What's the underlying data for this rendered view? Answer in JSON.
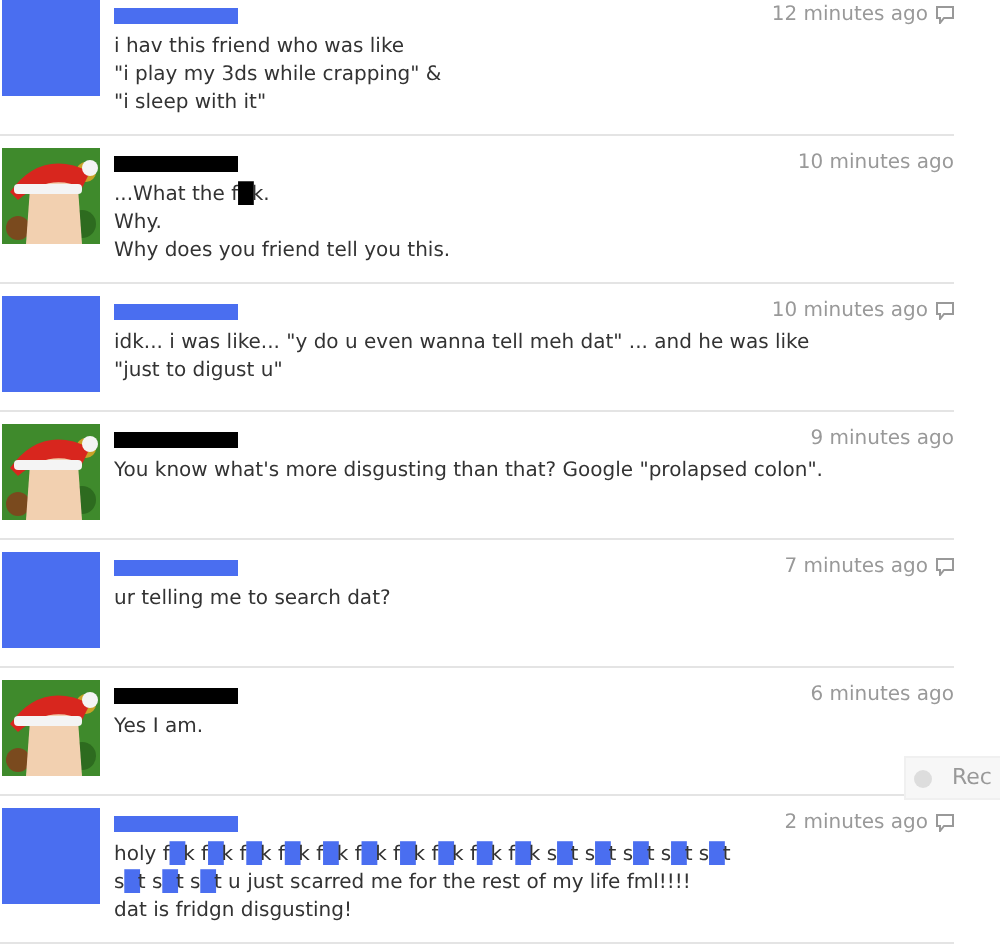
{
  "messages": [
    {
      "avatar": {
        "kind": "blue"
      },
      "color": "#4a6ef0",
      "time": "12 minutes ago",
      "comment_icon": true,
      "lines": [
        "i hav this friend who was like",
        "\"i play my 3ds while crapping\" &",
        "\"i sleep with it\""
      ]
    },
    {
      "avatar": {
        "kind": "picture"
      },
      "color": "#000000",
      "time": "10 minutes ago",
      "comment_icon": false,
      "lines": [
        "...What the f█k.",
        "Why.",
        "Why does you friend tell you this."
      ]
    },
    {
      "avatar": {
        "kind": "blue"
      },
      "color": "#4a6ef0",
      "time": "10 minutes ago",
      "comment_icon": true,
      "lines": [
        "idk... i was like... \"y do u even wanna tell meh dat\" ... and he was like",
        "\"just to digust u\""
      ]
    },
    {
      "avatar": {
        "kind": "picture"
      },
      "color": "#000000",
      "time": "9 minutes ago",
      "comment_icon": false,
      "lines": [
        "You know what's more disgusting than that? Google \"prolapsed colon\"."
      ]
    },
    {
      "avatar": {
        "kind": "blue"
      },
      "color": "#4a6ef0",
      "time": "7 minutes ago",
      "comment_icon": true,
      "lines": [
        "ur telling me to search dat?"
      ]
    },
    {
      "avatar": {
        "kind": "picture"
      },
      "color": "#000000",
      "time": "6 minutes ago",
      "comment_icon": false,
      "lines": [
        "Yes I am."
      ]
    },
    {
      "avatar": {
        "kind": "blue"
      },
      "color": "#4a6ef0",
      "time": "2 minutes ago",
      "comment_icon": true,
      "lines": [
        "holy f█k f█k f█k f█k f█k f█k f█k f█k f█k f█k s█t s█t s█t s█t s█t",
        "s█t s█t s█t u just scarred me for the rest of my life fml!!!!",
        "dat is fridgn disgusting!"
      ]
    }
  ],
  "side_widget": {
    "label": "Rec"
  }
}
